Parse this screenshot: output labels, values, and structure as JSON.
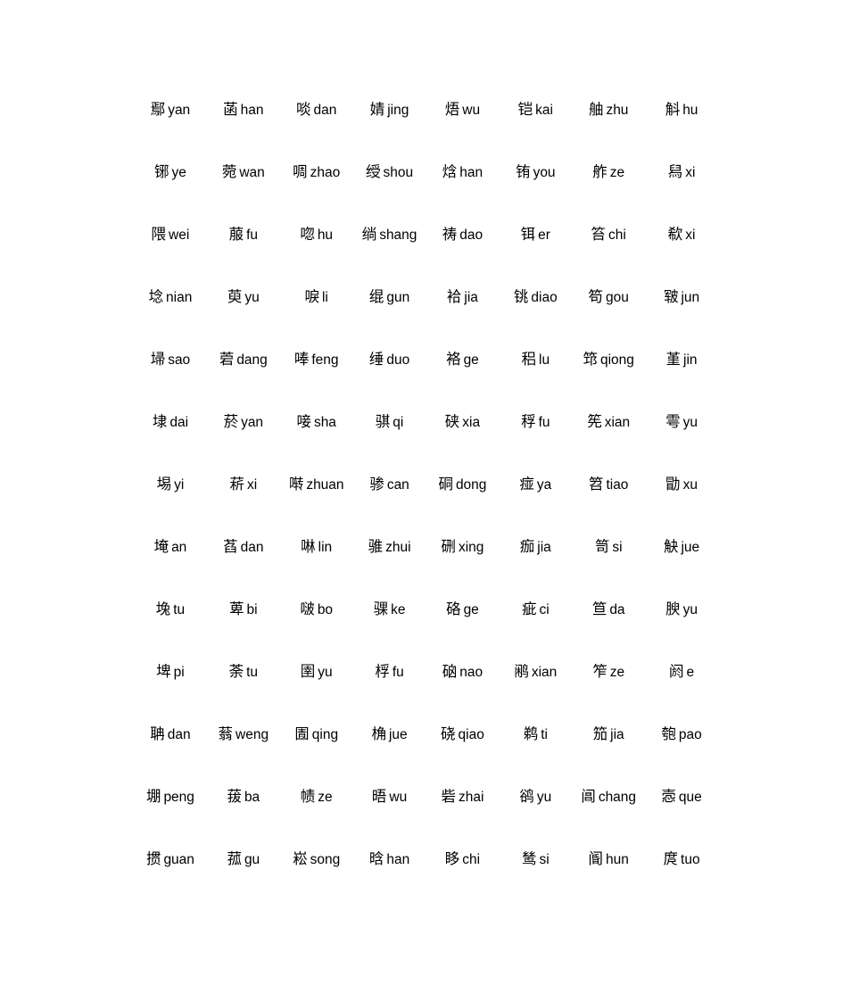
{
  "document": {
    "page_background": "#ffffff",
    "text_color": "#000000",
    "columns": 8,
    "rows": 13
  },
  "entries": [
    [
      {
        "hanzi": "鄢",
        "pinyin": "yan"
      },
      {
        "hanzi": "菡",
        "pinyin": "han"
      },
      {
        "hanzi": "啖",
        "pinyin": "dan"
      },
      {
        "hanzi": "婧",
        "pinyin": "jing"
      },
      {
        "hanzi": "焐",
        "pinyin": "wu"
      },
      {
        "hanzi": "铠",
        "pinyin": "kai"
      },
      {
        "hanzi": "舳",
        "pinyin": "zhu"
      },
      {
        "hanzi": "斛",
        "pinyin": "hu"
      }
    ],
    [
      {
        "hanzi": "铘",
        "pinyin": "ye"
      },
      {
        "hanzi": "菀",
        "pinyin": "wan"
      },
      {
        "hanzi": "啁",
        "pinyin": "zhao"
      },
      {
        "hanzi": "绶",
        "pinyin": "shou"
      },
      {
        "hanzi": "焓",
        "pinyin": "han"
      },
      {
        "hanzi": "铕",
        "pinyin": "you"
      },
      {
        "hanzi": "舴",
        "pinyin": "ze"
      },
      {
        "hanzi": "舄",
        "pinyin": "xi"
      }
    ],
    [
      {
        "hanzi": "隈",
        "pinyin": "wei"
      },
      {
        "hanzi": "菔",
        "pinyin": "fu"
      },
      {
        "hanzi": "唿",
        "pinyin": "hu"
      },
      {
        "hanzi": "绱",
        "pinyin": "shang"
      },
      {
        "hanzi": "祷",
        "pinyin": "dao"
      },
      {
        "hanzi": "铒",
        "pinyin": "er"
      },
      {
        "hanzi": "笞",
        "pinyin": "chi"
      },
      {
        "hanzi": "欷",
        "pinyin": "xi"
      }
    ],
    [
      {
        "hanzi": "埝",
        "pinyin": "nian"
      },
      {
        "hanzi": "萸",
        "pinyin": "yu"
      },
      {
        "hanzi": "唳",
        "pinyin": "li"
      },
      {
        "hanzi": "绲",
        "pinyin": "gun"
      },
      {
        "hanzi": "袷",
        "pinyin": "jia"
      },
      {
        "hanzi": "铫",
        "pinyin": "diao"
      },
      {
        "hanzi": "笱",
        "pinyin": "gou"
      },
      {
        "hanzi": "皲",
        "pinyin": "jun"
      }
    ],
    [
      {
        "hanzi": "埽",
        "pinyin": "sao"
      },
      {
        "hanzi": "菪",
        "pinyin": "dang"
      },
      {
        "hanzi": "唪",
        "pinyin": "feng"
      },
      {
        "hanzi": "缍",
        "pinyin": "duo"
      },
      {
        "hanzi": "袼",
        "pinyin": "ge"
      },
      {
        "hanzi": "稆",
        "pinyin": "lu"
      },
      {
        "hanzi": "筇",
        "pinyin": "qiong"
      },
      {
        "hanzi": "堇",
        "pinyin": "jin"
      }
    ],
    [
      {
        "hanzi": "埭",
        "pinyin": "dai"
      },
      {
        "hanzi": "菸",
        "pinyin": "yan"
      },
      {
        "hanzi": "唼",
        "pinyin": "sha"
      },
      {
        "hanzi": "骐",
        "pinyin": "qi"
      },
      {
        "hanzi": "硖",
        "pinyin": "xia"
      },
      {
        "hanzi": "稃",
        "pinyin": "fu"
      },
      {
        "hanzi": "筅",
        "pinyin": "xian"
      },
      {
        "hanzi": "雩",
        "pinyin": "yu"
      }
    ],
    [
      {
        "hanzi": "埸",
        "pinyin": "yi"
      },
      {
        "hanzi": "菥",
        "pinyin": "xi"
      },
      {
        "hanzi": "啭",
        "pinyin": "zhuan"
      },
      {
        "hanzi": "骖",
        "pinyin": "can"
      },
      {
        "hanzi": "硐",
        "pinyin": "dong"
      },
      {
        "hanzi": "痖",
        "pinyin": "ya"
      },
      {
        "hanzi": "笤",
        "pinyin": "tiao"
      },
      {
        "hanzi": "勖",
        "pinyin": "xu"
      }
    ],
    [
      {
        "hanzi": "埯",
        "pinyin": "an"
      },
      {
        "hanzi": "萏",
        "pinyin": "dan"
      },
      {
        "hanzi": "啉",
        "pinyin": "lin"
      },
      {
        "hanzi": "骓",
        "pinyin": "zhui"
      },
      {
        "hanzi": "硎",
        "pinyin": "xing"
      },
      {
        "hanzi": "痂",
        "pinyin": "jia"
      },
      {
        "hanzi": "笥",
        "pinyin": "si"
      },
      {
        "hanzi": "觖",
        "pinyin": "jue"
      }
    ],
    [
      {
        "hanzi": "堍",
        "pinyin": "tu"
      },
      {
        "hanzi": "萆",
        "pinyin": "bi"
      },
      {
        "hanzi": "啵",
        "pinyin": "bo"
      },
      {
        "hanzi": "骒",
        "pinyin": "ke"
      },
      {
        "hanzi": "硌",
        "pinyin": "ge"
      },
      {
        "hanzi": "疵",
        "pinyin": "ci"
      },
      {
        "hanzi": "笪",
        "pinyin": "da"
      },
      {
        "hanzi": "腴",
        "pinyin": "yu"
      }
    ],
    [
      {
        "hanzi": "埤",
        "pinyin": "pi"
      },
      {
        "hanzi": "荼",
        "pinyin": "tu"
      },
      {
        "hanzi": "圉",
        "pinyin": "yu"
      },
      {
        "hanzi": "桴",
        "pinyin": "fu"
      },
      {
        "hanzi": "硇",
        "pinyin": "nao"
      },
      {
        "hanzi": "鹇",
        "pinyin": "xian"
      },
      {
        "hanzi": "笮",
        "pinyin": "ze"
      },
      {
        "hanzi": "阏",
        "pinyin": "e"
      }
    ],
    [
      {
        "hanzi": "聃",
        "pinyin": "dan"
      },
      {
        "hanzi": "蓊",
        "pinyin": "weng"
      },
      {
        "hanzi": "圊",
        "pinyin": "qing"
      },
      {
        "hanzi": "桷",
        "pinyin": "jue"
      },
      {
        "hanzi": "硗",
        "pinyin": "qiao"
      },
      {
        "hanzi": "鹈",
        "pinyin": "ti"
      },
      {
        "hanzi": "笳",
        "pinyin": "jia"
      },
      {
        "hanzi": "匏",
        "pinyin": "pao"
      }
    ],
    [
      {
        "hanzi": "堋",
        "pinyin": "peng"
      },
      {
        "hanzi": "菝",
        "pinyin": "ba"
      },
      {
        "hanzi": "帻",
        "pinyin": "ze"
      },
      {
        "hanzi": "晤",
        "pinyin": "wu"
      },
      {
        "hanzi": "砦",
        "pinyin": "zhai"
      },
      {
        "hanzi": "鹆",
        "pinyin": "yu"
      },
      {
        "hanzi": "阊",
        "pinyin": "chang"
      },
      {
        "hanzi": "悫",
        "pinyin": "que"
      }
    ],
    [
      {
        "hanzi": "掼",
        "pinyin": "guan"
      },
      {
        "hanzi": "菰",
        "pinyin": "gu"
      },
      {
        "hanzi": "崧",
        "pinyin": "song"
      },
      {
        "hanzi": "晗",
        "pinyin": "han"
      },
      {
        "hanzi": "眵",
        "pinyin": "chi"
      },
      {
        "hanzi": "鸶",
        "pinyin": "si"
      },
      {
        "hanzi": "阍",
        "pinyin": "hun"
      },
      {
        "hanzi": "庹",
        "pinyin": "tuo"
      }
    ]
  ]
}
